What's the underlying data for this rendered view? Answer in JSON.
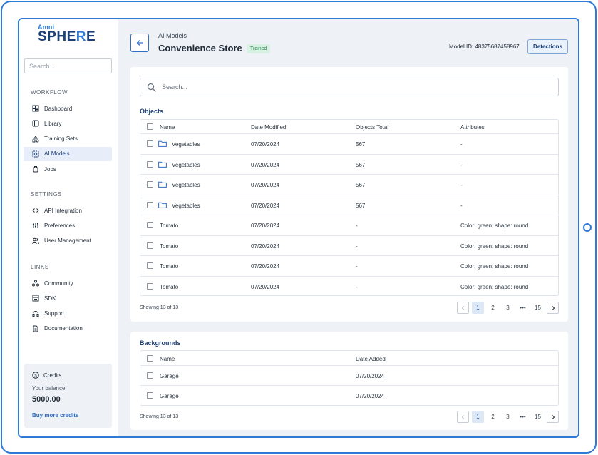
{
  "brand": {
    "top": "Amni",
    "main_a": "SPHE",
    "main_b": "R",
    "main_c": "E"
  },
  "sidebar": {
    "search_placeholder": "Search...",
    "workflow_title": "WORKFLOW",
    "workflow": [
      {
        "label": "Dashboard",
        "icon": "dashboard-icon"
      },
      {
        "label": "Library",
        "icon": "library-icon"
      },
      {
        "label": "Training Sets",
        "icon": "training-sets-icon"
      },
      {
        "label": "AI Models",
        "icon": "ai-models-icon",
        "active": true
      },
      {
        "label": "Jobs",
        "icon": "jobs-icon"
      }
    ],
    "settings_title": "SETTINGS",
    "settings": [
      {
        "label": "API Integration",
        "icon": "code-icon"
      },
      {
        "label": "Preferences",
        "icon": "sliders-icon"
      },
      {
        "label": "User Management",
        "icon": "users-icon"
      }
    ],
    "links_title": "LINKS",
    "links": [
      {
        "label": "Community",
        "icon": "community-icon"
      },
      {
        "label": "SDK",
        "icon": "sdk-icon"
      },
      {
        "label": "Support",
        "icon": "headset-icon"
      },
      {
        "label": "Documentation",
        "icon": "document-icon"
      }
    ],
    "credits": {
      "title": "Credits",
      "balance_label": "Your balance:",
      "balance": "5000.00",
      "buy_label": "Buy more credits"
    }
  },
  "header": {
    "breadcrumb": "AI Models",
    "title": "Convenience Store",
    "status": "Trained",
    "model_id": "Model ID: 48375687458967",
    "detections_label": "Detections"
  },
  "objects": {
    "search_placeholder": "Search...",
    "title": "Objects",
    "columns": [
      "Name",
      "Date Modified",
      "Objects Total",
      "Attributes"
    ],
    "rows": [
      {
        "name": "Vegetables",
        "date": "07/20/2024",
        "total": "567",
        "attributes": "-",
        "folder": true
      },
      {
        "name": "Vegetables",
        "date": "07/20/2024",
        "total": "567",
        "attributes": "-",
        "folder": true
      },
      {
        "name": "Vegetables",
        "date": "07/20/2024",
        "total": "567",
        "attributes": "-",
        "folder": true
      },
      {
        "name": "Vegetables",
        "date": "07/20/2024",
        "total": "567",
        "attributes": "-",
        "folder": true
      },
      {
        "name": "Tomato",
        "date": "07/20/2024",
        "total": "-",
        "attributes": "Color: green; shape: round",
        "folder": false
      },
      {
        "name": "Tomato",
        "date": "07/20/2024",
        "total": "-",
        "attributes": "Color: green; shape: round",
        "folder": false
      },
      {
        "name": "Tomato",
        "date": "07/20/2024",
        "total": "-",
        "attributes": "Color: green; shape: round",
        "folder": false
      },
      {
        "name": "Tomato",
        "date": "07/20/2024",
        "total": "-",
        "attributes": "Color: green; shape: round",
        "folder": false
      }
    ],
    "showing": "Showing 13 of 13",
    "pages": [
      "1",
      "2",
      "3",
      "•••",
      "15"
    ]
  },
  "backgrounds": {
    "title": "Backgrounds",
    "columns": [
      "Name",
      "Date Added"
    ],
    "rows": [
      {
        "name": "Garage",
        "date": "07/20/2024"
      },
      {
        "name": "Garage",
        "date": "07/20/2024"
      }
    ],
    "showing": "Showing 13 of 13",
    "pages": [
      "1",
      "2",
      "3",
      "•••",
      "15"
    ]
  },
  "colors": {
    "accent": "#2f7ad6",
    "navy": "#1b3f77",
    "badge_bg": "#d9f1e3",
    "badge_text": "#2f8a55"
  }
}
